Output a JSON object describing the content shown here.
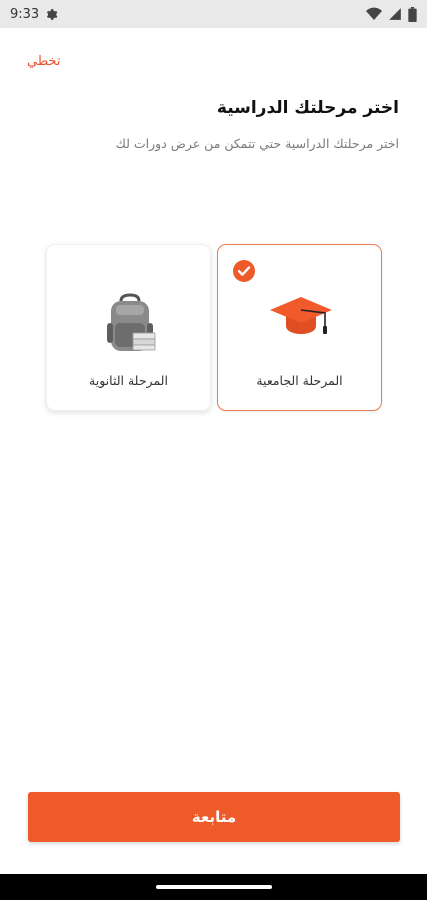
{
  "status_bar": {
    "time": "9:33",
    "icons": [
      "gear-icon",
      "wifi-icon",
      "signal-icon",
      "battery-icon"
    ]
  },
  "skip_label": "تخطي",
  "title": "اختر مرحلتك الدراسية",
  "subtitle": "اختر مرحلتك الدراسية حتي تتمكن من عرض دورات لك",
  "options": [
    {
      "label": "المرحلة الجامعية",
      "icon": "graduation-cap-icon",
      "selected": true
    },
    {
      "label": "المرحلة الثانوية",
      "icon": "backpack-icon",
      "selected": false
    }
  ],
  "continue_label": "متابعة",
  "colors": {
    "accent": "#ee5a2a",
    "selected_border": "#f0785a",
    "title_text": "#111111",
    "subtitle_text": "#7a7a7a"
  }
}
